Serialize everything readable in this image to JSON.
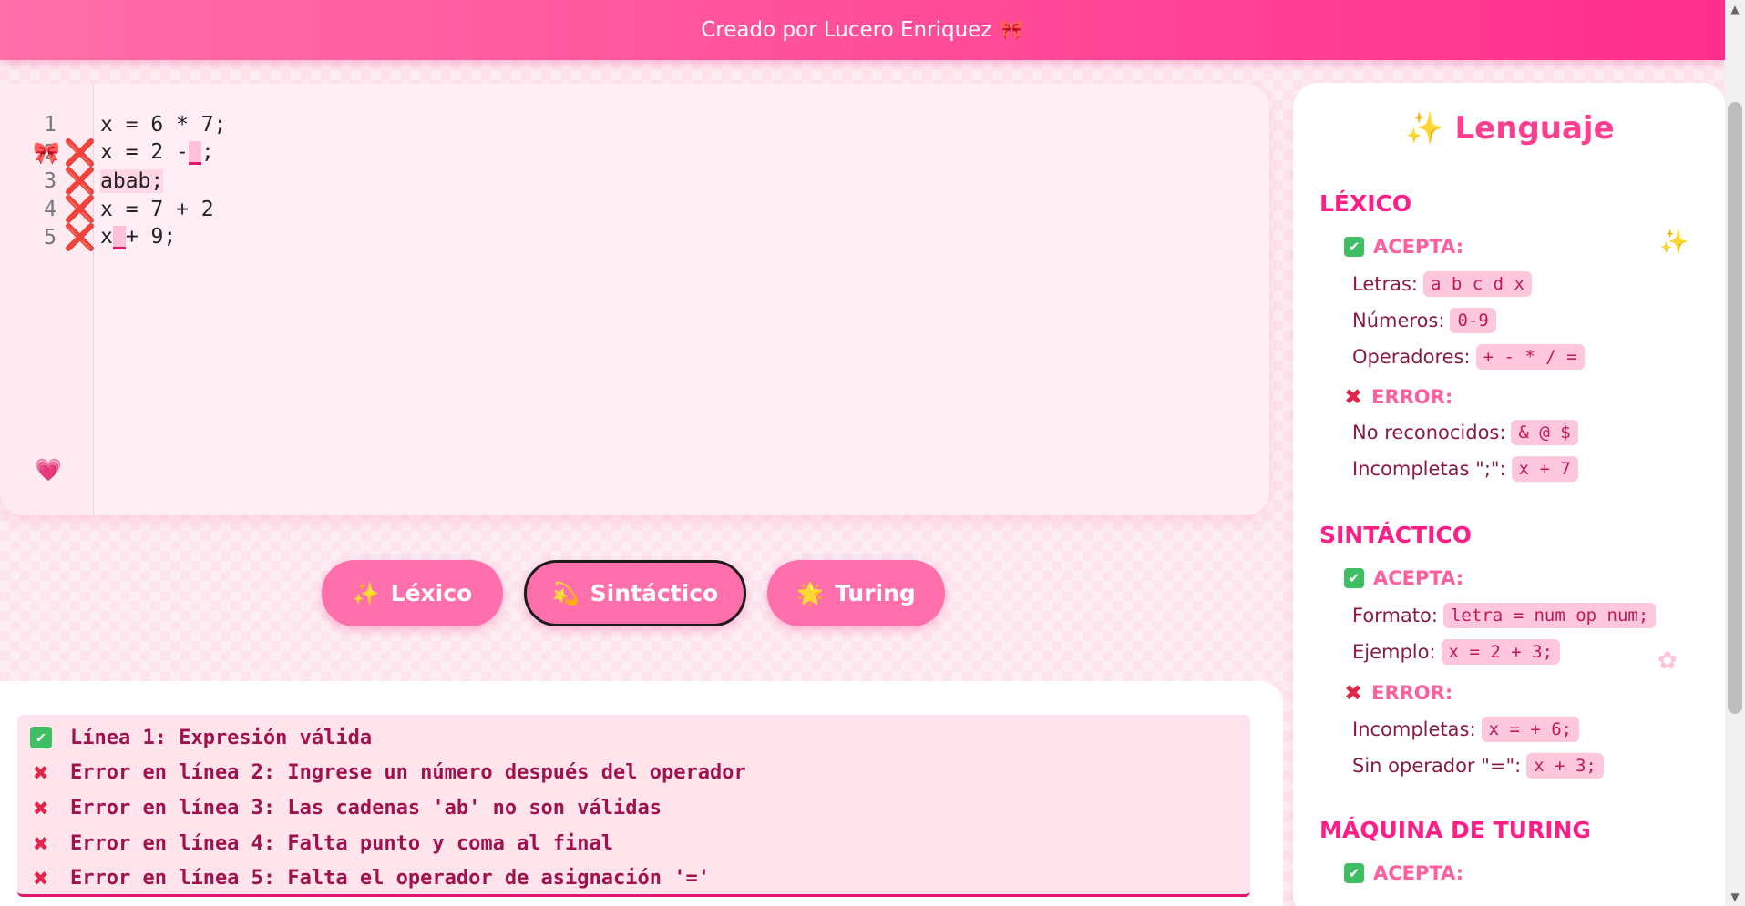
{
  "header": {
    "credit": "Creado por Lucero Enriquez",
    "bow": "🎀"
  },
  "editor": {
    "lines": [
      {
        "num": "1",
        "error": false,
        "parts": [
          {
            "t": "x = 6 * 7;"
          }
        ]
      },
      {
        "num": "2",
        "error": true,
        "parts": [
          {
            "t": "x = 2 -"
          },
          {
            "caret": true
          },
          {
            "t": ";"
          }
        ]
      },
      {
        "num": "3",
        "error": true,
        "parts": [
          {
            "t": "abab;",
            "hl": true
          }
        ]
      },
      {
        "num": "4",
        "error": true,
        "parts": [
          {
            "t": "x = 7 + 2"
          }
        ]
      },
      {
        "num": "5",
        "error": true,
        "parts": [
          {
            "t": "x"
          },
          {
            "caret": true
          },
          {
            "t": "+ 9;"
          }
        ]
      }
    ],
    "error_mark": "❌",
    "deco_bow": "🎀",
    "deco_heart": "💗"
  },
  "buttons": {
    "lexico": {
      "icon": "✨",
      "label": "Léxico"
    },
    "sintactico": {
      "icon": "💫",
      "label": "Sintáctico"
    },
    "turing": {
      "icon": "🌟",
      "label": "Turing"
    }
  },
  "results": [
    {
      "status": "ok",
      "text": "Línea 1: Expresión válida"
    },
    {
      "status": "err",
      "text": "Error en línea 2: Ingrese un número después del operador"
    },
    {
      "status": "err",
      "text": "Error en línea 3: Las cadenas 'ab' no son válidas"
    },
    {
      "status": "err",
      "text": "Error en línea 4: Falta punto y coma al final"
    },
    {
      "status": "err",
      "text": "Error en línea 5: Falta el operador de asignación '='"
    }
  ],
  "panel": {
    "title": "✨ Lenguaje",
    "lexico": {
      "title": "LÉXICO",
      "accept": "ACEPTA:",
      "letras_label": "Letras:",
      "letras": "a b c d x",
      "numeros_label": "Números:",
      "numeros": "0-9",
      "operadores_label": "Operadores:",
      "operadores": "+ - * / =",
      "error": "ERROR:",
      "noreco_label": "No reconocidos:",
      "noreco": "& @ $",
      "incomp_label": "Incompletas \";\":",
      "incomp": "x + 7"
    },
    "sintactico": {
      "title": "SINTÁCTICO",
      "accept": "ACEPTA:",
      "formato_label": "Formato:",
      "formato": "letra = num op num;",
      "ejemplo_label": "Ejemplo:",
      "ejemplo": "x = 2 + 3;",
      "error": "ERROR:",
      "incomp_label": "Incompletas:",
      "incomp": "x = + 6;",
      "sinop_label": "Sin operador \"=\":",
      "sinop": "x + 3;"
    },
    "turing": {
      "title": "MÁQUINA DE TURING",
      "accept": "ACEPTA:"
    }
  },
  "colors": {
    "accent": "#ff4f9a",
    "error": "#e0264b",
    "ok": "#3fbf63"
  }
}
